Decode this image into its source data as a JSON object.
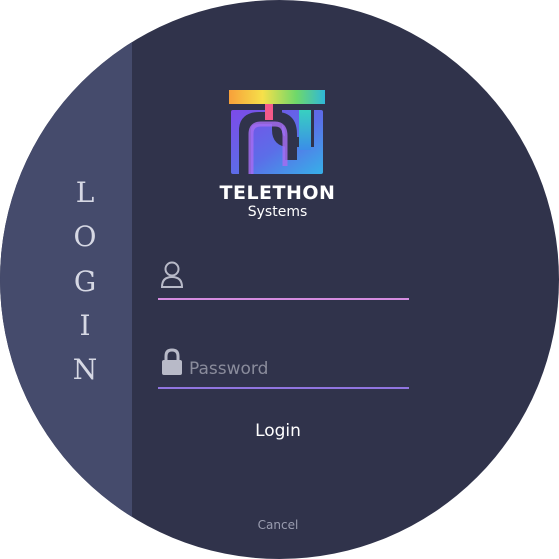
{
  "sidebar": {
    "letters": [
      "L",
      "O",
      "G",
      "I",
      "N"
    ]
  },
  "brand": {
    "name": "TELETHON",
    "tagline": "Systems"
  },
  "form": {
    "username": {
      "value": "",
      "placeholder": "",
      "icon": "user-icon",
      "underline_color": "#d58de0"
    },
    "password": {
      "value": "",
      "placeholder": "Password",
      "icon": "lock-icon",
      "underline_color": "#9075e0"
    },
    "login_label": "Login",
    "cancel_label": "Cancel"
  },
  "colors": {
    "panel": "#30334b",
    "sidebar": "#454b6c",
    "text": "#ffffff",
    "muted": "#9a9db0"
  }
}
